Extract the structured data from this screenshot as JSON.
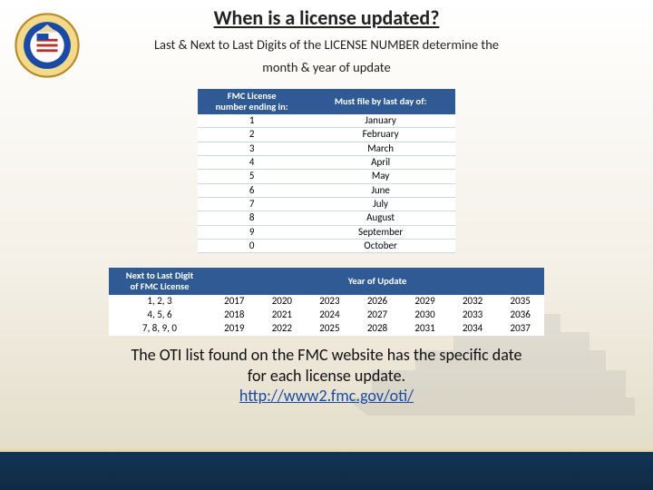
{
  "title": "When is a license updated?",
  "subtitle_line1": "Last & Next to Last Digits of the LICENSE NUMBER determine the",
  "subtitle_line2": "month & year of update",
  "table1": {
    "head_left_l1": "FMC License",
    "head_left_l2": "number ending in:",
    "head_right": "Must file by last day of:",
    "rows": [
      {
        "n": "1",
        "m": "January"
      },
      {
        "n": "2",
        "m": "February"
      },
      {
        "n": "3",
        "m": "March"
      },
      {
        "n": "4",
        "m": "April"
      },
      {
        "n": "5",
        "m": "May"
      },
      {
        "n": "6",
        "m": "June"
      },
      {
        "n": "7",
        "m": "July"
      },
      {
        "n": "8",
        "m": "August"
      },
      {
        "n": "9",
        "m": "September"
      },
      {
        "n": "0",
        "m": "October"
      }
    ]
  },
  "table2": {
    "head_left_l1": "Next to Last Digit",
    "head_left_l2": "of FMC License",
    "head_right": "Year of Update",
    "rows": [
      {
        "label": "1, 2, 3",
        "years": [
          "2017",
          "2020",
          "2023",
          "2026",
          "2029",
          "2032",
          "2035"
        ]
      },
      {
        "label": "4, 5, 6",
        "years": [
          "2018",
          "2021",
          "2024",
          "2027",
          "2030",
          "2033",
          "2036"
        ]
      },
      {
        "label": "7, 8, 9, 0",
        "years": [
          "2019",
          "2022",
          "2025",
          "2028",
          "2031",
          "2034",
          "2037"
        ]
      }
    ]
  },
  "footer_l1": "The OTI list found on the FMC website has the specific date",
  "footer_l2": "for each license update.",
  "footer_link": "http://www2.fmc.gov/oti/",
  "seal_alt": "Federal Maritime Commission seal",
  "colors": {
    "navy": "#2f5a93",
    "bottom_bar": "#0f2a44"
  }
}
